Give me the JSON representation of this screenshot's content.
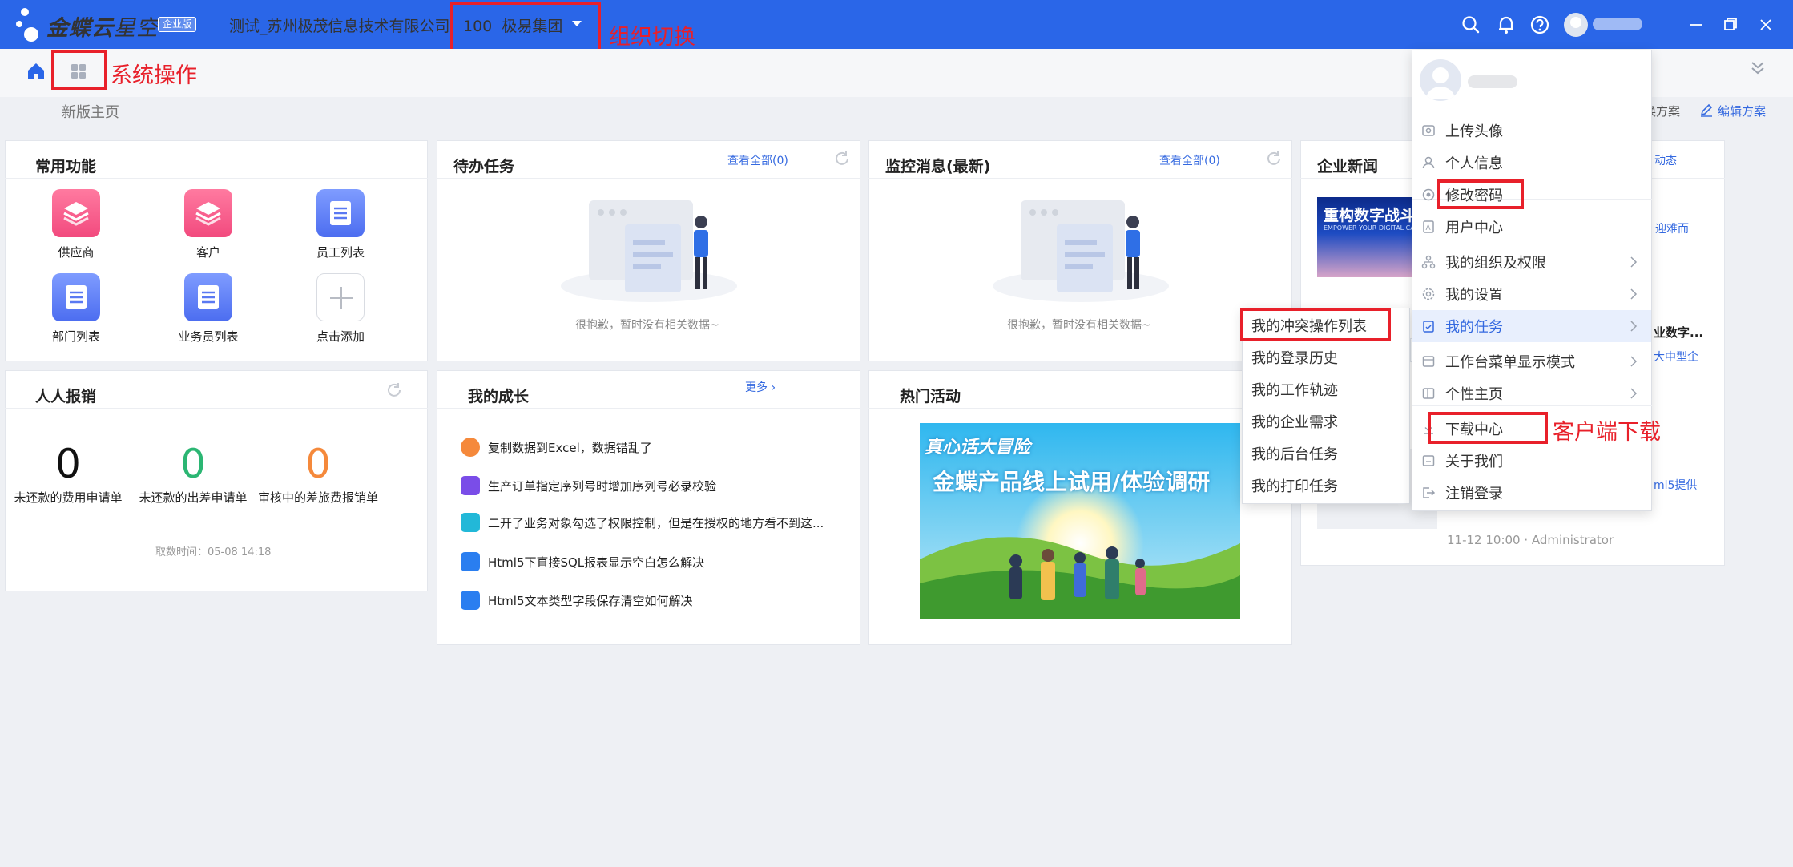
{
  "header": {
    "logo_main": "金蝶云",
    "logo_sub": "星空",
    "edition_badge": "企业版",
    "tenant": "测试_苏州极茂信息技术有限公司",
    "org_code": "100",
    "org_name": "极易集团",
    "brand_color": "#2a66e8",
    "icons": [
      "search-icon",
      "bell-icon",
      "help-icon",
      "user-avatar",
      "minimize-icon",
      "restore-icon",
      "close-icon"
    ]
  },
  "annotations": {
    "org_switch": "组织切换",
    "system_ops": "系统操作",
    "client_download": "客户端下载",
    "color": "#e8202a"
  },
  "subbar": {
    "breadcrumb": "新版主页",
    "switch_scheme": "换方案",
    "edit_scheme": "编辑方案"
  },
  "common_functions": {
    "title": "常用功能",
    "items": [
      {
        "label": "供应商",
        "icon": "layers-icon"
      },
      {
        "label": "客户",
        "icon": "layers-icon"
      },
      {
        "label": "员工列表",
        "icon": "list-icon"
      },
      {
        "label": "部门列表",
        "icon": "list-icon"
      },
      {
        "label": "业务员列表",
        "icon": "list-icon"
      },
      {
        "label": "点击添加",
        "icon": "plus-icon"
      }
    ]
  },
  "pending_tasks": {
    "title": "待办任务",
    "view_all": "查看全部(0)",
    "empty": "很抱歉，暂时没有相关数据~"
  },
  "monitor": {
    "title": "监控消息(最新)",
    "view_all": "查看全部(0)",
    "empty": "很抱歉，暂时没有相关数据~"
  },
  "news": {
    "title": "企业新闻",
    "more": "动态",
    "banner_text": "重构数字战斗",
    "banner_sub": "EMPOWER YOUR DIGITAL CAPA",
    "snippet1": "迎难而",
    "snippet2": "业数字...",
    "snippet3": "大中型企",
    "snippet4": "ml5提供",
    "meta": "11-12 10:00 · Administrator"
  },
  "reimburse": {
    "title": "人人报销",
    "stats": [
      {
        "value": "0",
        "label": "未还款的费用申请单",
        "color": "#111111"
      },
      {
        "value": "0",
        "label": "未还款的出差申请单",
        "color": "#2bb673"
      },
      {
        "value": "0",
        "label": "审核中的差旅费报销单",
        "color": "#f5893b"
      }
    ],
    "fetch_time": "取数时间：05-08 14:18"
  },
  "growth": {
    "title": "我的成长",
    "more": "更多",
    "items": [
      {
        "text": "复制数据到Excel，数据错乱了",
        "color": "#f5893b"
      },
      {
        "text": "生产订单指定序列号时增加序列号必录校验",
        "color": "#7a4de8"
      },
      {
        "text": "二开了业务对象勾选了权限控制，但是在授权的地方看不到这...",
        "color": "#22b8d8"
      },
      {
        "text": "Html5下直接SQL报表显示空白怎么解决",
        "color": "#2a7ef0"
      },
      {
        "text": "Html5文本类型字段保存清空如何解决",
        "color": "#2a7ef0"
      }
    ]
  },
  "hot": {
    "title": "热门活动",
    "banner_tag": "真心话大冒险",
    "banner_title": "金蝶产品线上试用/体验调研"
  },
  "user_menu": {
    "items": [
      {
        "label": "上传头像",
        "icon": "image-icon"
      },
      {
        "label": "个人信息",
        "icon": "user-icon"
      },
      {
        "label": "修改密码",
        "icon": "key-icon"
      },
      {
        "label": "用户中心",
        "icon": "id-card-icon"
      },
      {
        "label": "我的组织及权限",
        "icon": "org-icon",
        "submenu": true
      },
      {
        "label": "我的设置",
        "icon": "gear-icon",
        "submenu": true
      },
      {
        "label": "我的任务",
        "icon": "clipboard-icon",
        "submenu": true,
        "active": true
      },
      {
        "label": "工作台菜单显示模式",
        "icon": "layout-icon",
        "submenu": true
      },
      {
        "label": "个性主页",
        "icon": "page-icon",
        "submenu": true
      },
      {
        "label": "下载中心",
        "icon": "download-icon"
      },
      {
        "label": "关于我们",
        "icon": "info-icon"
      },
      {
        "label": "注销登录",
        "icon": "logout-icon"
      }
    ]
  },
  "task_submenu": {
    "items": [
      "我的冲突操作列表",
      "我的登录历史",
      "我的工作轨迹",
      "我的企业需求",
      "我的后台任务",
      "我的打印任务"
    ]
  }
}
